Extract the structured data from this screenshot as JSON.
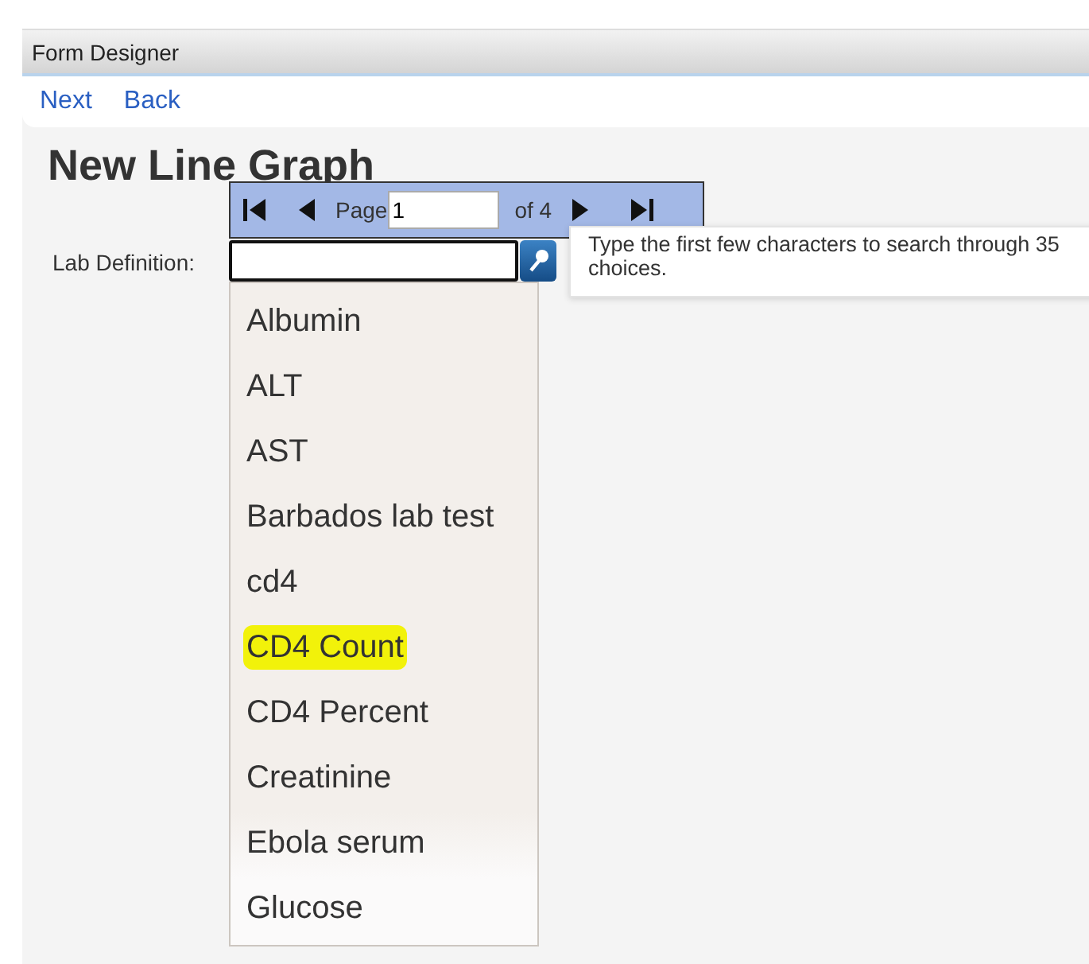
{
  "header": {
    "title": "Form Designer"
  },
  "nav": [
    "Next",
    "Back"
  ],
  "page_title": "New Line Graph",
  "field": {
    "label": "Lab Definition:"
  },
  "pager": {
    "label": "Page",
    "page": "1",
    "of": "of 4"
  },
  "tooltip": "Type the first few characters to search through 35 choices.",
  "choices": [
    {
      "label": "Albumin",
      "selected": false
    },
    {
      "label": "ALT",
      "selected": false
    },
    {
      "label": "AST",
      "selected": false
    },
    {
      "label": "Barbados lab test",
      "selected": false
    },
    {
      "label": "cd4",
      "selected": false
    },
    {
      "label": "CD4 Count",
      "selected": true
    },
    {
      "label": "CD4 Percent",
      "selected": false
    },
    {
      "label": "Creatinine",
      "selected": false
    },
    {
      "label": "Ebola serum",
      "selected": false
    },
    {
      "label": "Glucose",
      "selected": false
    }
  ]
}
